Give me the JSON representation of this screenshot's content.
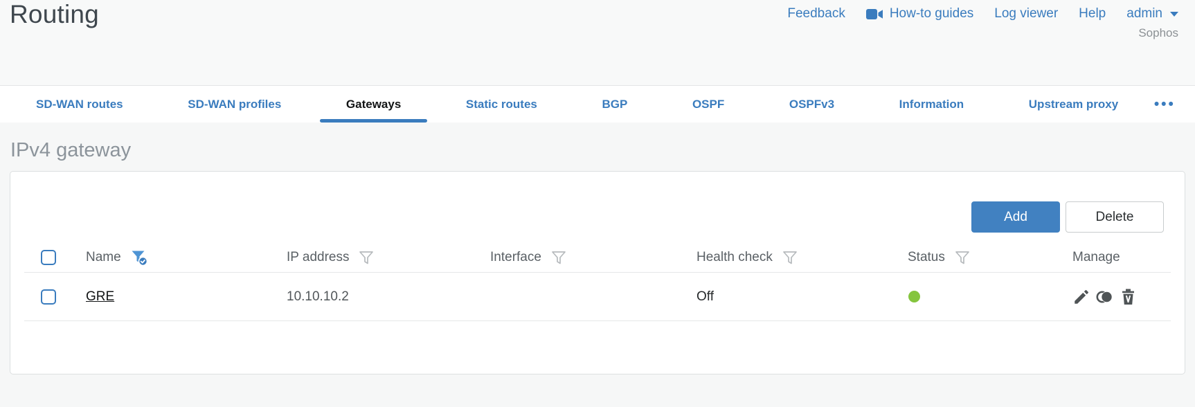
{
  "page_title": "Routing",
  "header": {
    "links": [
      {
        "label": "Feedback"
      },
      {
        "label": "How-to guides",
        "icon": "video-camera"
      },
      {
        "label": "Log viewer"
      },
      {
        "label": "Help"
      }
    ],
    "user": {
      "name": "admin"
    },
    "brand": "Sophos"
  },
  "tabs": [
    {
      "label": "SD-WAN routes",
      "active": false
    },
    {
      "label": "SD-WAN profiles",
      "active": false
    },
    {
      "label": "Gateways",
      "active": true
    },
    {
      "label": "Static routes",
      "active": false
    },
    {
      "label": "BGP",
      "active": false
    },
    {
      "label": "OSPF",
      "active": false
    },
    {
      "label": "OSPFv3",
      "active": false
    },
    {
      "label": "Information",
      "active": false
    },
    {
      "label": "Upstream proxy",
      "active": false
    }
  ],
  "tabs_overflow": {
    "label": "•••"
  },
  "section": {
    "title": "IPv4 gateway"
  },
  "toolbar": {
    "add_label": "Add",
    "delete_label": "Delete"
  },
  "table": {
    "columns": [
      {
        "label": "Name",
        "filter": "active"
      },
      {
        "label": "IP address",
        "filter": "inactive"
      },
      {
        "label": "Interface",
        "filter": "inactive"
      },
      {
        "label": "Health check",
        "filter": "inactive"
      },
      {
        "label": "Status",
        "filter": "inactive"
      },
      {
        "label": "Manage",
        "filter": "none"
      }
    ],
    "rows": [
      {
        "name": "GRE",
        "ip_address": "10.10.10.2",
        "interface": "",
        "health_check": "Off",
        "status": "up"
      }
    ]
  },
  "colors": {
    "accent_blue": "#3a7cbe",
    "button_blue": "#4181c1",
    "status_up_green": "#85c53e"
  }
}
